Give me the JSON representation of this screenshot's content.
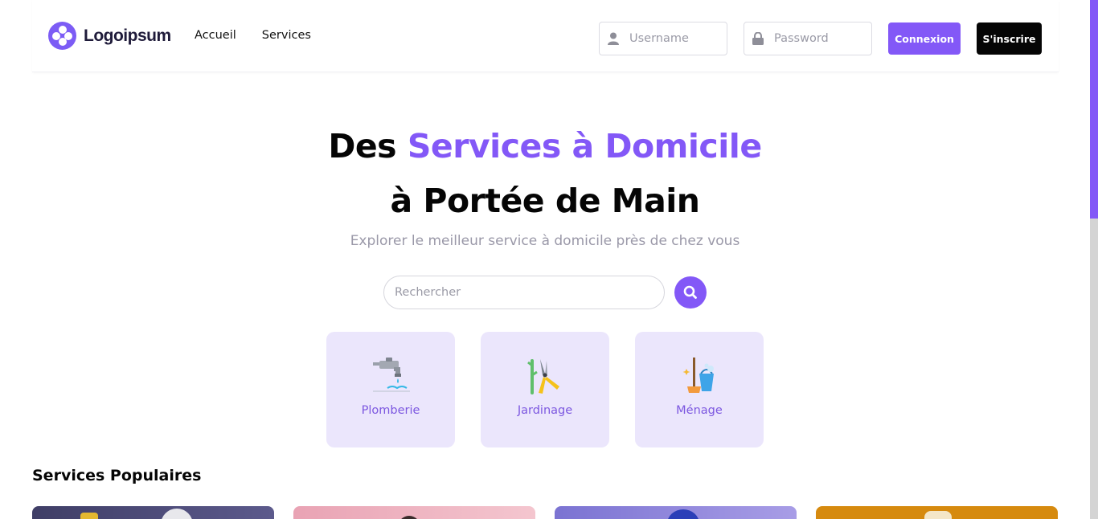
{
  "brand": {
    "name": "Logoipsum",
    "accent_color": "#8358f7"
  },
  "nav": {
    "items": [
      "Accueil",
      "Services"
    ]
  },
  "auth": {
    "username_placeholder": "Username",
    "password_placeholder": "Password",
    "login_label": "Connexion",
    "signup_label": "S'inscrire"
  },
  "hero": {
    "title_plain_1": "Des ",
    "title_accent": "Services à Domicile",
    "title_line_2": "à Portée de Main",
    "subtitle": "Explorer le meilleur service à domicile près de chez vous"
  },
  "search": {
    "placeholder": "Rechercher",
    "icon": "search-icon"
  },
  "categories": [
    {
      "label": "Plomberie",
      "icon": "faucet-icon"
    },
    {
      "label": "Jardinage",
      "icon": "pruning-shears-icon"
    },
    {
      "label": "Ménage",
      "icon": "cleaning-bucket-icon"
    }
  ],
  "popular": {
    "title": "Services Populaires"
  }
}
